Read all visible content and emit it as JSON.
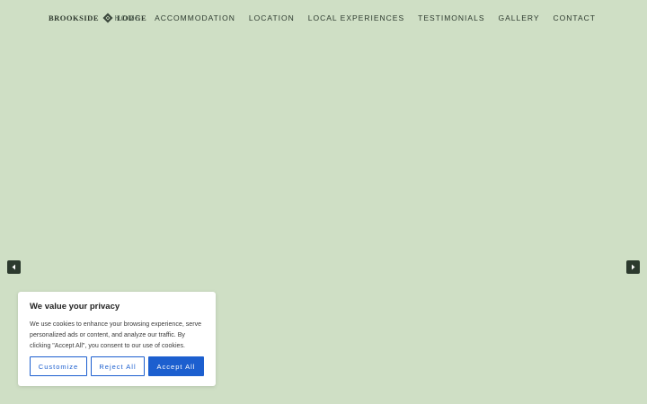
{
  "brand": {
    "name_left": "BROOKSIDE",
    "name_right": "LODGE",
    "logo_icon": "diamond-leaf-icon"
  },
  "nav": {
    "items": [
      {
        "label": "HOME",
        "active": true
      },
      {
        "label": "ACCOMMODATION",
        "active": false
      },
      {
        "label": "LOCATION",
        "active": false
      },
      {
        "label": "LOCAL EXPERIENCES",
        "active": false
      },
      {
        "label": "TESTIMONIALS",
        "active": false
      },
      {
        "label": "GALLERY",
        "active": false
      },
      {
        "label": "CONTACT",
        "active": false
      }
    ]
  },
  "slider": {
    "prev_icon": "caret-left-icon",
    "next_icon": "caret-right-icon"
  },
  "cookie_banner": {
    "title": "We value your privacy",
    "text": "We use cookies to enhance your browsing experience, serve personalized ads or content, and analyze our traffic. By clicking \"Accept All\", you consent to our use of cookies.",
    "customize_label": "Customize",
    "reject_label": "Reject All",
    "accept_label": "Accept All"
  },
  "colors": {
    "background": "#cfdfc5",
    "accent": "#1c5fcf",
    "dark": "#2c3a2e"
  }
}
